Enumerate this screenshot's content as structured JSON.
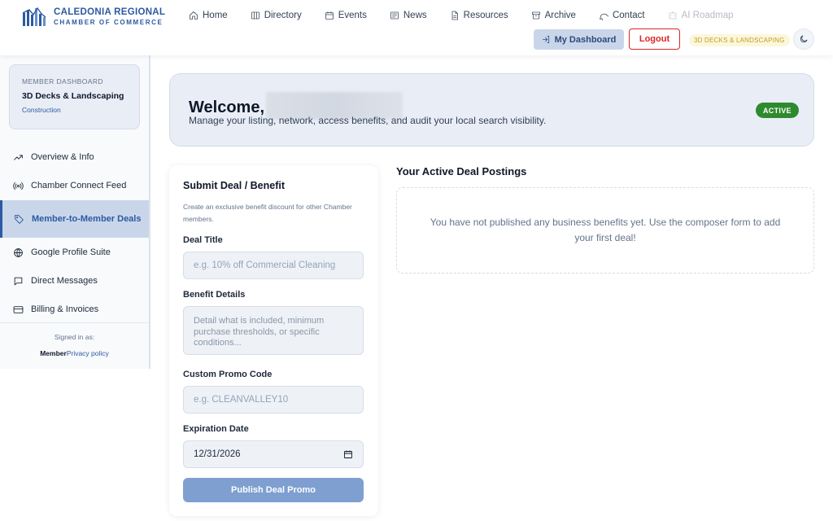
{
  "brand": {
    "title": "CALEDONIA REGIONAL",
    "subtitle": "CHAMBER OF COMMERCE",
    "color": "#2c5aa0"
  },
  "nav": {
    "items": [
      {
        "label": "Home",
        "icon": "home-icon"
      },
      {
        "label": "Directory",
        "icon": "building-icon"
      },
      {
        "label": "Events",
        "icon": "calendar-icon"
      },
      {
        "label": "News",
        "icon": "newspaper-icon"
      },
      {
        "label": "Resources",
        "icon": "file-icon"
      },
      {
        "label": "Archive",
        "icon": "archive-icon"
      },
      {
        "label": "Contact",
        "icon": "chat-bubble-icon"
      },
      {
        "label": "AI Roadmap",
        "icon": "robot-icon",
        "disabled": true
      }
    ],
    "dashboard_label": "My Dashboard",
    "logout_label": "Logout",
    "company_pill": "3D DECKS & LANDSCAPING",
    "theme_icon": "moon-icon"
  },
  "sidebar": {
    "card": {
      "label": "MEMBER DASHBOARD",
      "name": "3D Decks & Landscaping",
      "category": "Construction"
    },
    "items": [
      {
        "label": "Overview & Info",
        "icon": "trending-up-icon"
      },
      {
        "label": "Chamber Connect Feed",
        "icon": "broadcast-icon"
      },
      {
        "label": "Member-to-Member Deals",
        "icon": "tag-icon",
        "active": true
      },
      {
        "label": "Google Profile Suite",
        "icon": "globe-icon"
      },
      {
        "label": "Direct Messages",
        "icon": "message-icon"
      },
      {
        "label": "Billing & Invoices",
        "icon": "credit-card-icon"
      }
    ],
    "footer": {
      "signed_in": "Signed in as:",
      "role": "Member",
      "privacy": "Privacy policy"
    }
  },
  "welcome": {
    "title": "Welcome,",
    "subtitle": "Manage your listing, network, access benefits, and audit your local search visibility.",
    "status": "ACTIVE",
    "status_color": "#2f8a2f"
  },
  "form": {
    "title": "Submit Deal / Benefit",
    "description": "Create an exclusive benefit discount for other Chamber members.",
    "deal_title_label": "Deal Title",
    "deal_title_placeholder": "e.g. 10% off Commercial Cleaning",
    "details_label": "Benefit Details",
    "details_placeholder": "Detail what is included, minimum purchase thresholds, or specific conditions...",
    "promo_label": "Custom Promo Code",
    "promo_placeholder": "e.g. CLEANVALLEY10",
    "expiry_label": "Expiration Date",
    "expiry_value": "12/31/2026",
    "publish_label": "Publish Deal Promo"
  },
  "postings": {
    "title": "Your Active Deal Postings",
    "empty_message": "You have not published any business benefits yet. Use the composer form to add your first deal!"
  }
}
